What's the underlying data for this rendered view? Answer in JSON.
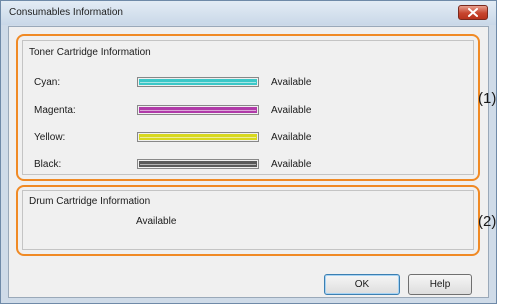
{
  "window": {
    "title": "Consumables Information"
  },
  "toner": {
    "group_label": "Toner Cartridge Information",
    "rows": [
      {
        "label": "Cyan:",
        "status": "Available",
        "color": "#3cc8c8"
      },
      {
        "label": "Magenta:",
        "status": "Available",
        "color": "#b03aa8"
      },
      {
        "label": "Yellow:",
        "status": "Available",
        "color": "#d8d81e"
      },
      {
        "label": "Black:",
        "status": "Available",
        "color": "#5a5a5a"
      }
    ]
  },
  "drum": {
    "group_label": "Drum Cartridge Information",
    "status": "Available"
  },
  "callouts": {
    "one": "(1)",
    "two": "(2)"
  },
  "buttons": {
    "ok": "OK",
    "help": "Help"
  },
  "colors": {
    "highlight": "#f08a25",
    "close_button": "#c7452e"
  }
}
